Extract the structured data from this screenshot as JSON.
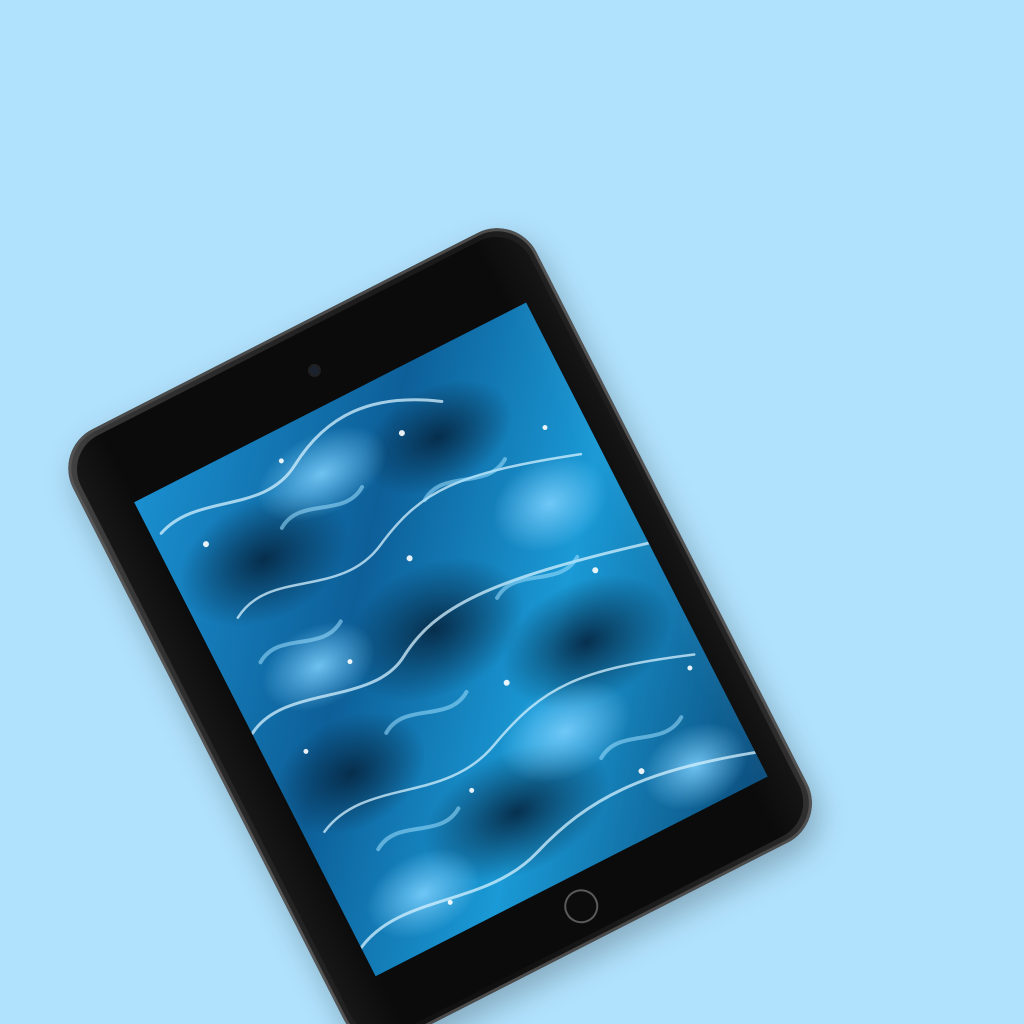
{
  "scene": {
    "background_color": "#b1e2fd",
    "device": "tablet",
    "device_color": "#111111",
    "screen_content": "water-ripple-wallpaper",
    "screen_colors": [
      "#0a5d93",
      "#1a9ad6",
      "#0b3f66",
      "#bde9ff"
    ]
  },
  "icons": {
    "camera": "camera-icon",
    "home": "home-button-icon"
  }
}
